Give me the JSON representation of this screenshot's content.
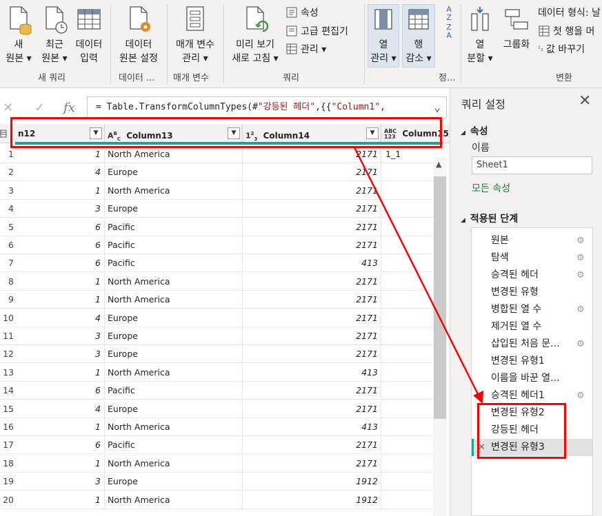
{
  "ribbon": {
    "new_source": "새\n원본 ▾",
    "recent_sources": "최근\n원본 ▾",
    "enter_data": "데이터\n입력",
    "group_new_query": "새 쿼리",
    "data_source_settings": "데이터\n원본 설정",
    "group_data_sources": "데이터 ...",
    "manage_parameters": "매개 변수\n관리 ▾",
    "group_parameters": "매개 변수",
    "refresh_preview": "미리 보기\n새로 고침 ▾",
    "properties": "속성",
    "advanced_editor": "고급 편집기",
    "manage": "관리 ▾",
    "group_query": "쿼리",
    "choose_columns": "열\n관리 ▾",
    "reduce_rows": "행\n감소 ▾",
    "group_sort": "정...",
    "split_column": "열\n분할 ▾",
    "group_by": "그룹화",
    "data_type": "데이터 형식: 날",
    "first_row_header": "첫 행을 머",
    "replace_values": "값 바꾸기",
    "group_transform": "변환"
  },
  "formula": {
    "cancel": "✕",
    "accept": "✓",
    "fx": "fx",
    "prefix": "= Table.TransformColumnTypes(#",
    "str1": "\"강등된 헤더\"",
    "mid": ",{{",
    "str2": "\"Column1\"",
    "suffix": ",",
    "expand": "⌄"
  },
  "grid": {
    "headers": {
      "col12": "n12",
      "col13": "Column13",
      "col14": "Column14",
      "col15": "Column15"
    },
    "type_icons": {
      "col13": "ABC",
      "col14": "123",
      "col15": "ABC/123"
    },
    "rows": [
      {
        "n": "1",
        "c12": "1",
        "c13": "North America",
        "c14": "2171",
        "c15": "1_1"
      },
      {
        "n": "2",
        "c12": "4",
        "c13": "Europe",
        "c14": "2171",
        "c15": ""
      },
      {
        "n": "3",
        "c12": "1",
        "c13": "North America",
        "c14": "2171",
        "c15": ""
      },
      {
        "n": "4",
        "c12": "3",
        "c13": "Europe",
        "c14": "2171",
        "c15": ""
      },
      {
        "n": "5",
        "c12": "6",
        "c13": "Pacific",
        "c14": "2171",
        "c15": ""
      },
      {
        "n": "6",
        "c12": "6",
        "c13": "Pacific",
        "c14": "2171",
        "c15": ""
      },
      {
        "n": "7",
        "c12": "6",
        "c13": "Pacific",
        "c14": "413",
        "c15": ""
      },
      {
        "n": "8",
        "c12": "1",
        "c13": "North America",
        "c14": "2171",
        "c15": ""
      },
      {
        "n": "9",
        "c12": "1",
        "c13": "North America",
        "c14": "2171",
        "c15": ""
      },
      {
        "n": "10",
        "c12": "4",
        "c13": "Europe",
        "c14": "2171",
        "c15": ""
      },
      {
        "n": "11",
        "c12": "3",
        "c13": "Europe",
        "c14": "2171",
        "c15": ""
      },
      {
        "n": "12",
        "c12": "3",
        "c13": "Europe",
        "c14": "2171",
        "c15": ""
      },
      {
        "n": "13",
        "c12": "1",
        "c13": "North America",
        "c14": "413",
        "c15": ""
      },
      {
        "n": "14",
        "c12": "6",
        "c13": "Pacific",
        "c14": "2171",
        "c15": ""
      },
      {
        "n": "15",
        "c12": "4",
        "c13": "Europe",
        "c14": "2171",
        "c15": ""
      },
      {
        "n": "16",
        "c12": "1",
        "c13": "North America",
        "c14": "413",
        "c15": ""
      },
      {
        "n": "17",
        "c12": "6",
        "c13": "Pacific",
        "c14": "2171",
        "c15": ""
      },
      {
        "n": "18",
        "c12": "1",
        "c13": "North America",
        "c14": "2171",
        "c15": ""
      },
      {
        "n": "19",
        "c12": "3",
        "c13": "Europe",
        "c14": "1912",
        "c15": ""
      },
      {
        "n": "20",
        "c12": "1",
        "c13": "North America",
        "c14": "1912",
        "c15": ""
      }
    ]
  },
  "query_settings": {
    "title": "쿼리 설정",
    "properties_section": "속성",
    "name_label": "이름",
    "name_value": "Sheet1",
    "all_properties": "모든 속성",
    "applied_steps_section": "적용된 단계",
    "steps": [
      {
        "label": "원본",
        "gear": true
      },
      {
        "label": "탐색",
        "gear": true
      },
      {
        "label": "승격된 헤더",
        "gear": true
      },
      {
        "label": "변경된 유형",
        "gear": false
      },
      {
        "label": "병합된 열 수",
        "gear": true
      },
      {
        "label": "제거된 열 수",
        "gear": false
      },
      {
        "label": "삽입된 처음 문...",
        "gear": true
      },
      {
        "label": "변경된 유형1",
        "gear": false
      },
      {
        "label": "이름을 바꾼 열...",
        "gear": false
      },
      {
        "label": "승격된 헤더1",
        "gear": true
      },
      {
        "label": "변경된 유형2",
        "gear": false
      },
      {
        "label": "강등된 헤더",
        "gear": false
      },
      {
        "label": "변경된 유형3",
        "gear": false,
        "selected": true
      }
    ]
  },
  "colors": {
    "accent_teal": "#1aa39a",
    "annotation_red": "#ff0000",
    "link_green": "#217346"
  }
}
